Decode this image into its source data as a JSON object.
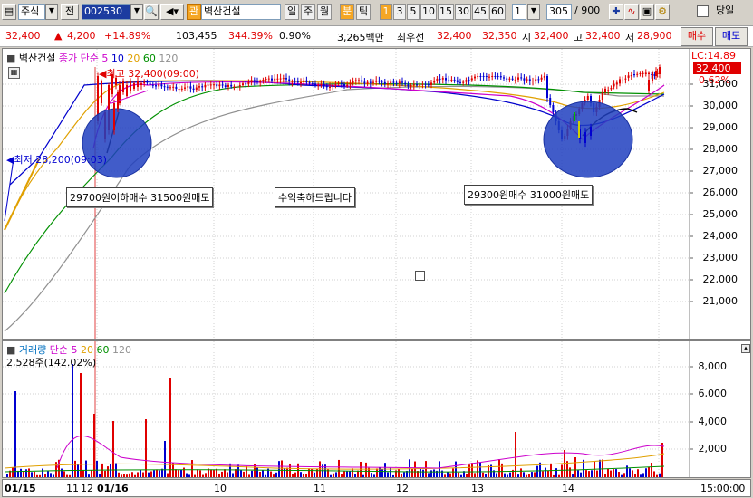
{
  "toolbar": {
    "market": "주식",
    "prev_label": "전",
    "code": "002530",
    "mode_badge": "관",
    "stock_name": "벽산건설",
    "periods": [
      "일",
      "주",
      "월",
      "분",
      "틱"
    ],
    "active_period": "분",
    "intervals": [
      "1",
      "3",
      "5",
      "10",
      "15",
      "30",
      "45",
      "60"
    ],
    "active_interval": "1",
    "interval_select": "1",
    "count": "305",
    "total": "/ 900",
    "today_label": "당일"
  },
  "ticker": {
    "price": "32,400",
    "change": "4,200",
    "change_pct": "+14.89%",
    "volume": "103,455",
    "volume_ratio": "344.39%",
    "turnover": "0.90%",
    "amount": "3,265백만",
    "best_label": "최우선",
    "ask": "32,400",
    "bid": "32,350",
    "open_label": "시",
    "open": "32,400",
    "high_label": "고",
    "high": "32,400",
    "low_label": "저",
    "low": "28,900",
    "buy_button": "매수",
    "sell_button": "매도"
  },
  "price_panel": {
    "stock_label": "벽산건설",
    "legend_close": "종가",
    "legend_ma_type": "단순",
    "ma": [
      "5",
      "10",
      "20",
      "60",
      "120"
    ],
    "ma_colors": [
      "#cc00cc",
      "#0000cc",
      "#e0a000",
      "#009000",
      "#909090"
    ],
    "lc_label": "LC:14.89",
    "price_tag": "32,400",
    "pct_tag": "0.62%",
    "high_marker": "최고 32,400(09:00)",
    "low_marker": "최저 28,200(09:03)",
    "annotations": [
      "29700원이하매수 31500원매도",
      "수익축하드립니다",
      "29300원매수 31000원매도"
    ],
    "y_ticks": [
      "31,000",
      "30,000",
      "29,000",
      "28,000",
      "27,000",
      "26,000",
      "25,000",
      "24,000",
      "23,000",
      "22,000",
      "21,000"
    ]
  },
  "volume_panel": {
    "label": "거래량",
    "ma_type": "단순",
    "ma": [
      "5",
      "20",
      "60",
      "120"
    ],
    "current": "2,528주(142.02%)",
    "y_ticks": [
      "8,000",
      "6,000",
      "4,000",
      "2,000"
    ]
  },
  "xaxis": {
    "labels": [
      "01/15",
      "11",
      "12",
      "01/16",
      "10",
      "11",
      "12",
      "13",
      "14"
    ],
    "time": "15:00:00"
  }
}
